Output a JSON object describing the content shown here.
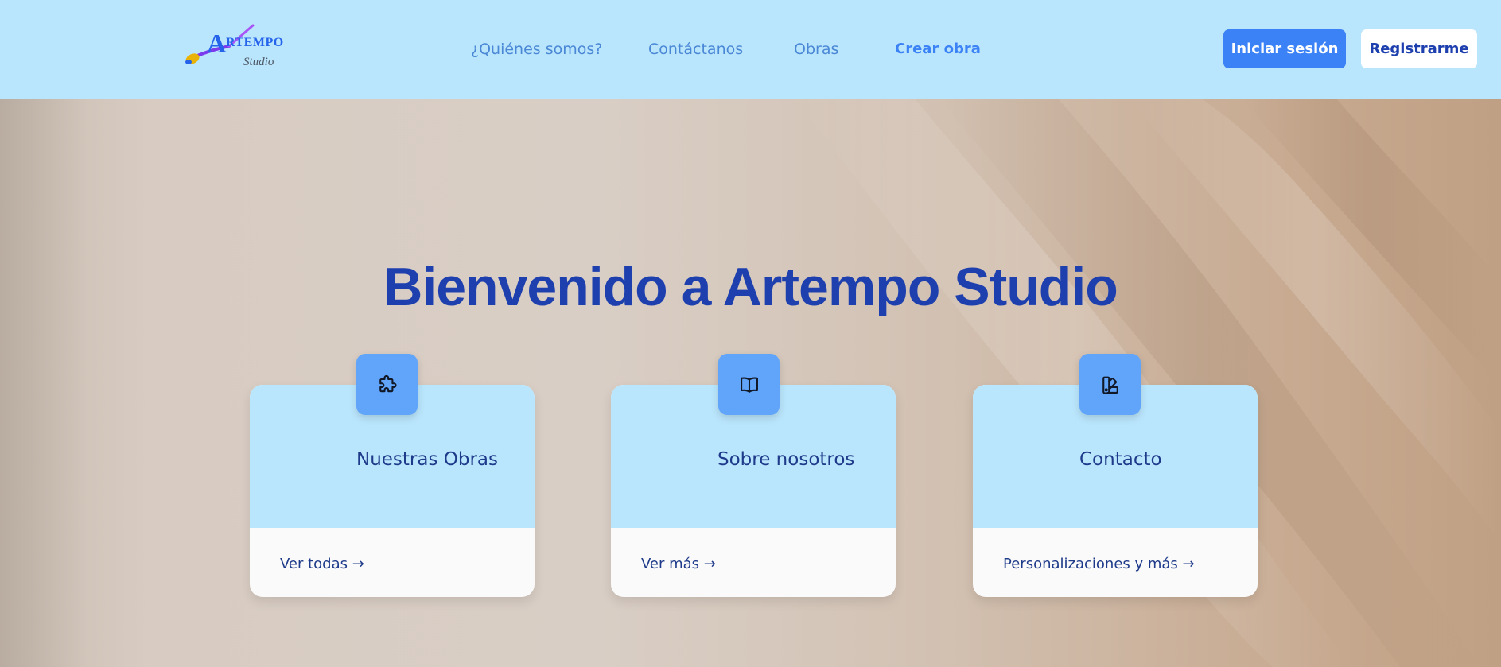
{
  "header": {
    "logo": {
      "main": "ARTEMPO",
      "sub": "Studio"
    },
    "nav": [
      {
        "label": "¿Quiénes somos?"
      },
      {
        "label": "Contáctanos"
      },
      {
        "label": "Obras"
      },
      {
        "label": "Crear obra"
      }
    ],
    "login_label": "Iniciar sesión",
    "register_label": "Registrarme"
  },
  "hero": {
    "title": "Bienvenido a Artempo Studio"
  },
  "cards": [
    {
      "title": "Nuestras Obras",
      "link": "Ver todas →",
      "icon": "puzzle-icon"
    },
    {
      "title": "Sobre nosotros",
      "link": "Ver más →",
      "icon": "book-open-icon"
    },
    {
      "title": "Contacto",
      "link": "Personalizaciones y más →",
      "icon": "swatch-icon"
    }
  ],
  "colors": {
    "header_bg": "#bae6fd",
    "primary": "#3b82f6",
    "title": "#1e40af",
    "card_top": "#bae6fd",
    "icon_box": "#60a5fa"
  }
}
